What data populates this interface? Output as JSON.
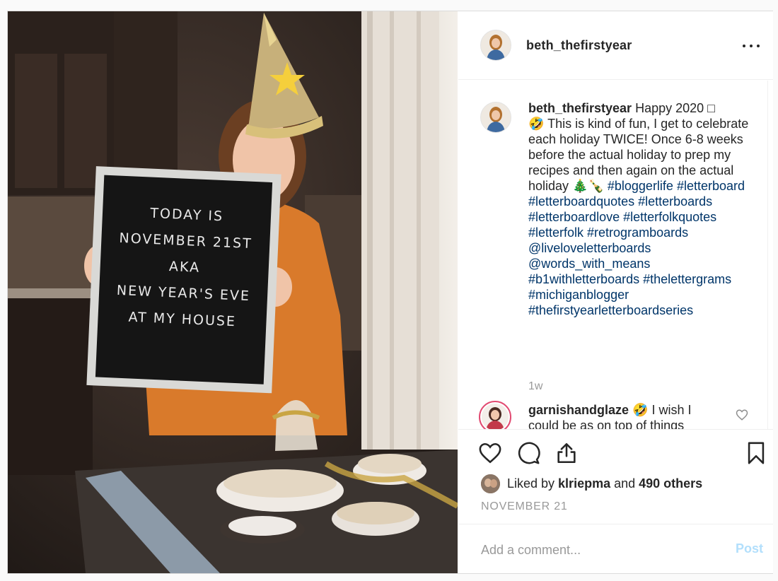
{
  "post": {
    "image": {
      "letterboard_text": "TODAY IS\nNOVEMBER 21ST\nAKA\nNEW YEAR'S EVE\nAT MY HOUSE"
    },
    "header": {
      "username": "beth_thefirstyear",
      "more_icon": "more-horizontal-icon"
    },
    "caption": {
      "username": "beth_thefirstyear",
      "text": " Happy 2020 □\n🤣 This is kind of fun, I get to celebrate each holiday TWICE! Once 6-8 weeks before the actual holiday to prep my recipes and then again on the actual holiday 🎄🍾",
      "tags": " #bloggerlife #letterboard #letterboardquotes #letterboards #letterboardlove #letterfolkquotes #letterfolk #retrogramboards @liveloveletterboards @words_with_means #b1withletterboards #thelettergrams #michiganblogger #thefirstyearletterboardseries",
      "age": "1w"
    },
    "comment": {
      "username": "garnishandglaze",
      "text": " 🤣 I wish I could be as on top of things"
    },
    "actions": {
      "like_icon": "heart-icon",
      "comment_icon": "comment-icon",
      "share_icon": "share-icon",
      "save_icon": "bookmark-icon"
    },
    "likes": {
      "prefix": "Liked by ",
      "user": "klriepma",
      "and": " and ",
      "others": "490 others"
    },
    "date": "NOVEMBER 21",
    "add_comment": {
      "placeholder": "Add a comment...",
      "post_label": "Post"
    },
    "colors": {
      "tag_link": "#003569",
      "muted": "#999999",
      "post_button": "#b2dffc",
      "story_ring": "#e14a71"
    }
  }
}
